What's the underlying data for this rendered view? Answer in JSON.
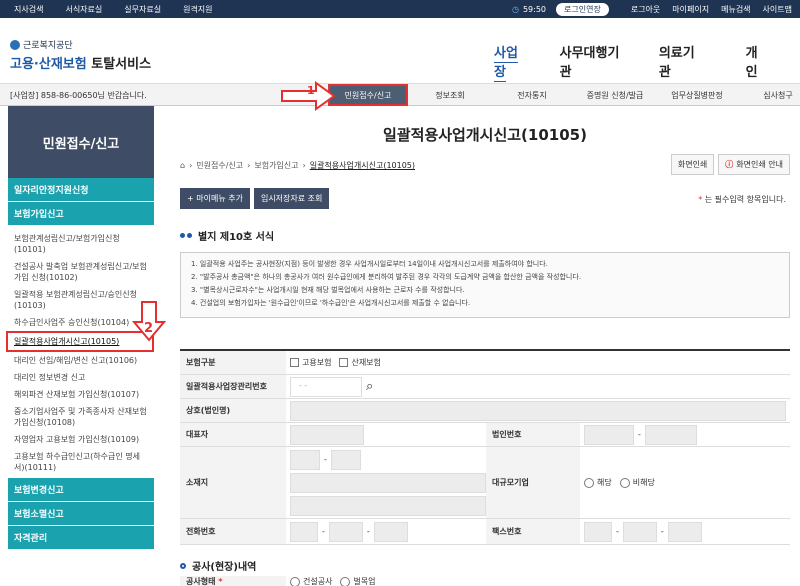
{
  "topbar": {
    "links": [
      "지사검색",
      "서식자료실",
      "실무자료실",
      "원격지원"
    ],
    "timer": "59:50",
    "extend": "로그인연장",
    "right_links": [
      "로그아웃",
      "마이페이지",
      "메뉴검색",
      "사이트맵"
    ]
  },
  "logo": {
    "org": "근로복지공단",
    "service_a": "고용·산재보험",
    "service_b": "토탈서비스"
  },
  "gnb": [
    "사업장",
    "사무대행기관",
    "의료기관",
    "개인"
  ],
  "welcome": "[사업장] 858-86-00650님 반갑습니다.",
  "submenu": [
    "민원접수/신고",
    "정보조회",
    "전자통지",
    "증명원 신청/발급",
    "업무상질병판정",
    "심사청구"
  ],
  "sidebar": {
    "title": "민원접수/신고",
    "cat1": "일자리안정지원신청",
    "cat2": "보험가입신고",
    "items": [
      "보험관계성립신고/보험가입신청(10101)",
      "건설공사 발축업 보험관계성립신고/보험가입 신청(10102)",
      "일괄적용 보험관계성립신고/승인신청(10103)",
      "하수급인사업주 승인신청(10104)",
      "일괄적용사업개시신고(10105)",
      "대리인 선임/해임/변신 신고(10106)",
      "대리인 정보변경 신고",
      "해외파견 산재보험 가입신청(10107)",
      "중소기업사업주 및 가족종사자 산재보험가입신청(10108)",
      "자영업자 고용보험 가입신청(10109)",
      "고용보험 하수급인신고(하수급인 명세서)(10111)"
    ],
    "cat3": "보험변경신고",
    "cat4": "보험소멸신고",
    "cat5": "자격관리"
  },
  "main": {
    "title": "일괄적용사업개시신고(10105)",
    "crumbs": [
      "민원접수/신고",
      "보험가입신고",
      "일괄적용사업개시신고(10105)"
    ],
    "print": "화면인쇄",
    "print_guide": "화면인쇄 안내",
    "btn_menu": "+ 마이메뉴 추가",
    "btn_temp": "임시저장자료 조회",
    "required_star": "*",
    "required_text": "는 필수입력 항목입니다.",
    "section": "별지 제10호 서식",
    "notice": [
      "1. 일괄적용 사업주는 공사현장(지점) 등이 발생한 경우 사업개시일로부터 14일이내 사업개시신고서를 제출하여야 합니다.",
      "2. \"발주공사 총금액\"은 하나의 총공사가 여러 원수급인에게 분리하여 발주된 경우 각각의 도급계약 금액을 합산한 금액을 작성합니다.",
      "3. \"별목상시근로자수\"는 사업개시일 현재 해당 벌목업에서 사용하는 근로자 수를 작성합니다.",
      "4. 건설업의 보험가입자는 '원수급인'이므로 '하수급인'은 사업개시신고서를 제출할 수 없습니다."
    ],
    "form": {
      "ins_type": "보험구분",
      "ins_emp": "고용보험",
      "ins_ind": "산재보험",
      "mgmt_no": "일괄적용사업장관리번호",
      "mgmt_placeholder": "-   -",
      "company": "상호(법인명)",
      "ceo": "대표자",
      "corp_no": "법인번호",
      "address": "소재지",
      "large": "대규모기업",
      "yes": "해당",
      "no": "비해당",
      "phone": "전화번호",
      "fax": "팩스번호"
    },
    "section2": "공사(현장)내역",
    "last_label": "공사형태",
    "last_opt1": "건설공사",
    "last_opt2": "벌목업"
  },
  "annotations": {
    "a1": "1",
    "a2": "2",
    "color": "#e43030"
  }
}
